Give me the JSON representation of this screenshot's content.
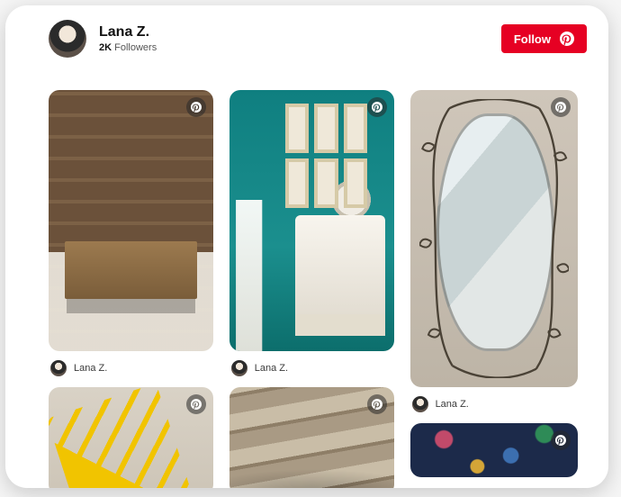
{
  "header": {
    "name": "Lana Z.",
    "follower_count": "2K",
    "followers_label": "Followers",
    "follow_button": "Follow"
  },
  "icons": {
    "pinterest": "pinterest-icon"
  },
  "pins": [
    {
      "id": "library",
      "author": "Lana Z."
    },
    {
      "id": "bathroom",
      "author": "Lana Z."
    },
    {
      "id": "mirror",
      "author": "Lana Z."
    },
    {
      "id": "yellow",
      "author": ""
    },
    {
      "id": "ceiling",
      "author": ""
    },
    {
      "id": "floral",
      "author": ""
    }
  ]
}
